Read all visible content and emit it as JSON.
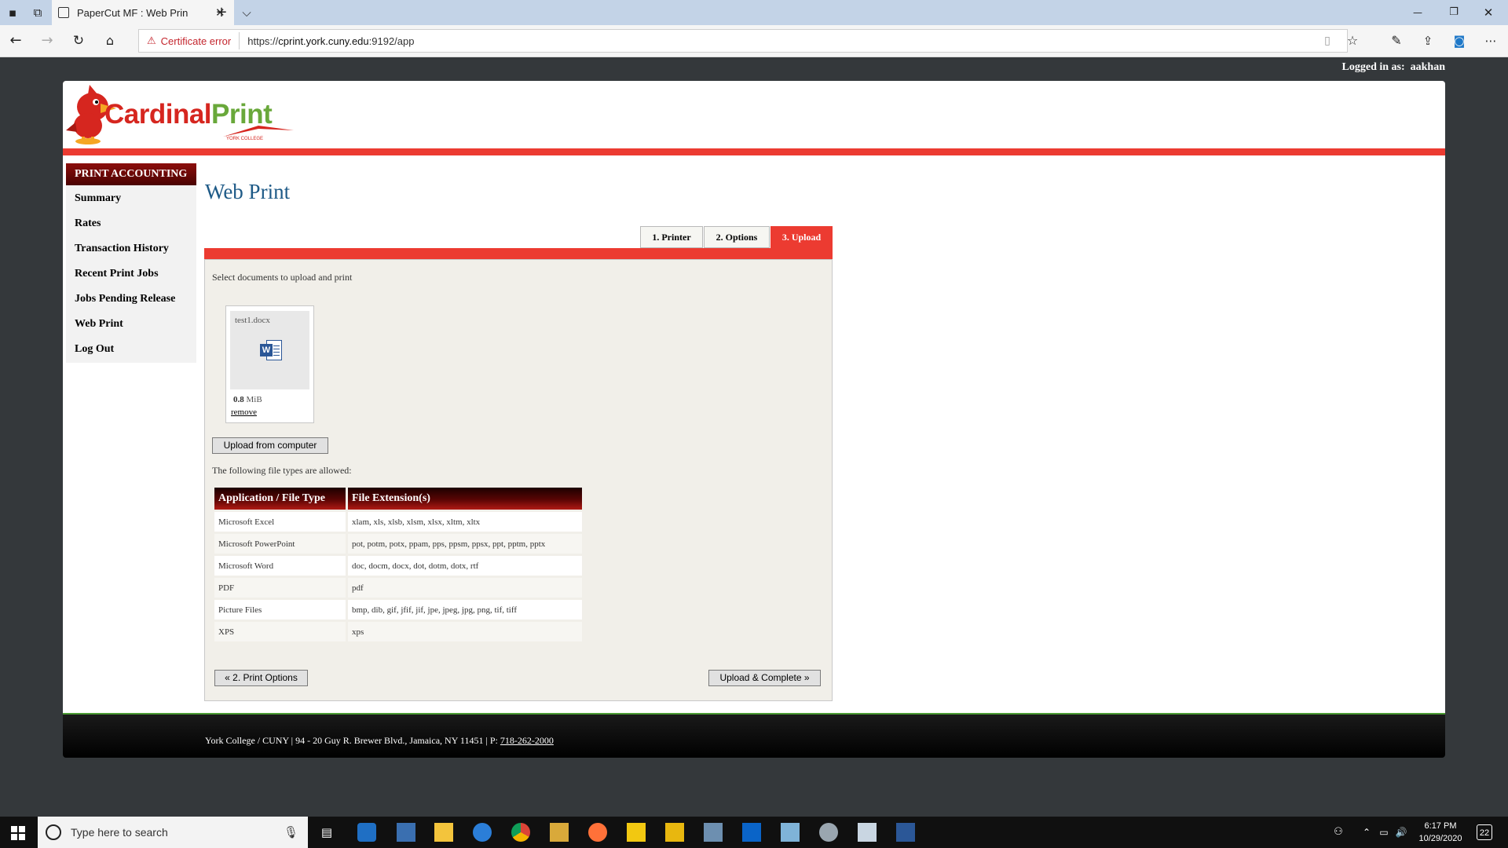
{
  "browser": {
    "tab_title": "PaperCut MF : Web Prin",
    "tab_close": "✕",
    "new_tab": "+",
    "tab_list": "⌵",
    "cert_label": "Certificate error",
    "url_scheme": "https://",
    "url_host": "cprint.york.cuny.edu",
    "url_rest": ":9192/app",
    "window_min": "—",
    "window_restore": "❐",
    "window_close": "✕"
  },
  "header": {
    "logged_in_label": "Logged in as:",
    "username": "aakhan",
    "logo_cardinal": "Cardinal",
    "logo_print": "Print",
    "logo_sub": "YORK COLLEGE"
  },
  "sidebar": {
    "heading": "PRINT ACCOUNTING",
    "items": [
      {
        "label": "Summary"
      },
      {
        "label": "Rates"
      },
      {
        "label": "Transaction History"
      },
      {
        "label": "Recent Print Jobs"
      },
      {
        "label": "Jobs Pending Release"
      },
      {
        "label": "Web Print"
      },
      {
        "label": "Log Out"
      }
    ]
  },
  "main": {
    "title": "Web Print",
    "steps": [
      {
        "label": "1. Printer",
        "active": false
      },
      {
        "label": "2. Options",
        "active": false
      },
      {
        "label": "3. Upload",
        "active": true
      }
    ],
    "instruction": "Select documents to upload and print",
    "file": {
      "name": "test1.docx",
      "size_value": "0.8",
      "size_unit": "MiB",
      "remove_label": "remove"
    },
    "upload_button": "Upload from computer",
    "allowed_text": "The following file types are allowed:",
    "table": {
      "headers": [
        "Application / File Type",
        "File Extension(s)"
      ],
      "rows": [
        [
          "Microsoft Excel",
          "xlam, xls, xlsb, xlsm, xlsx, xltm, xltx"
        ],
        [
          "Microsoft PowerPoint",
          "pot, potm, potx, ppam, pps, ppsm, ppsx, ppt, pptm, pptx"
        ],
        [
          "Microsoft Word",
          "doc, docm, docx, dot, dotm, dotx, rtf"
        ],
        [
          "PDF",
          "pdf"
        ],
        [
          "Picture Files",
          "bmp, dib, gif, jfif, jif, jpe, jpeg, jpg, png, tif, tiff"
        ],
        [
          "XPS",
          "xps"
        ]
      ]
    },
    "prev_button": "« 2. Print Options",
    "complete_button": "Upload & Complete »"
  },
  "footer": {
    "text": "York College / CUNY | 94 - 20 Guy R. Brewer Blvd., Jamaica, NY 11451 | P:",
    "phone": "718-262-2000"
  },
  "taskbar": {
    "search_placeholder": "Type here to search",
    "time": "6:17 PM",
    "date": "10/29/2020",
    "notification_count": "22"
  },
  "colors": {
    "accent_red": "#ec3b31",
    "title_blue": "#1e5a87",
    "nav_dark_red": "#6a0806",
    "logo_green": "#69a83a"
  }
}
